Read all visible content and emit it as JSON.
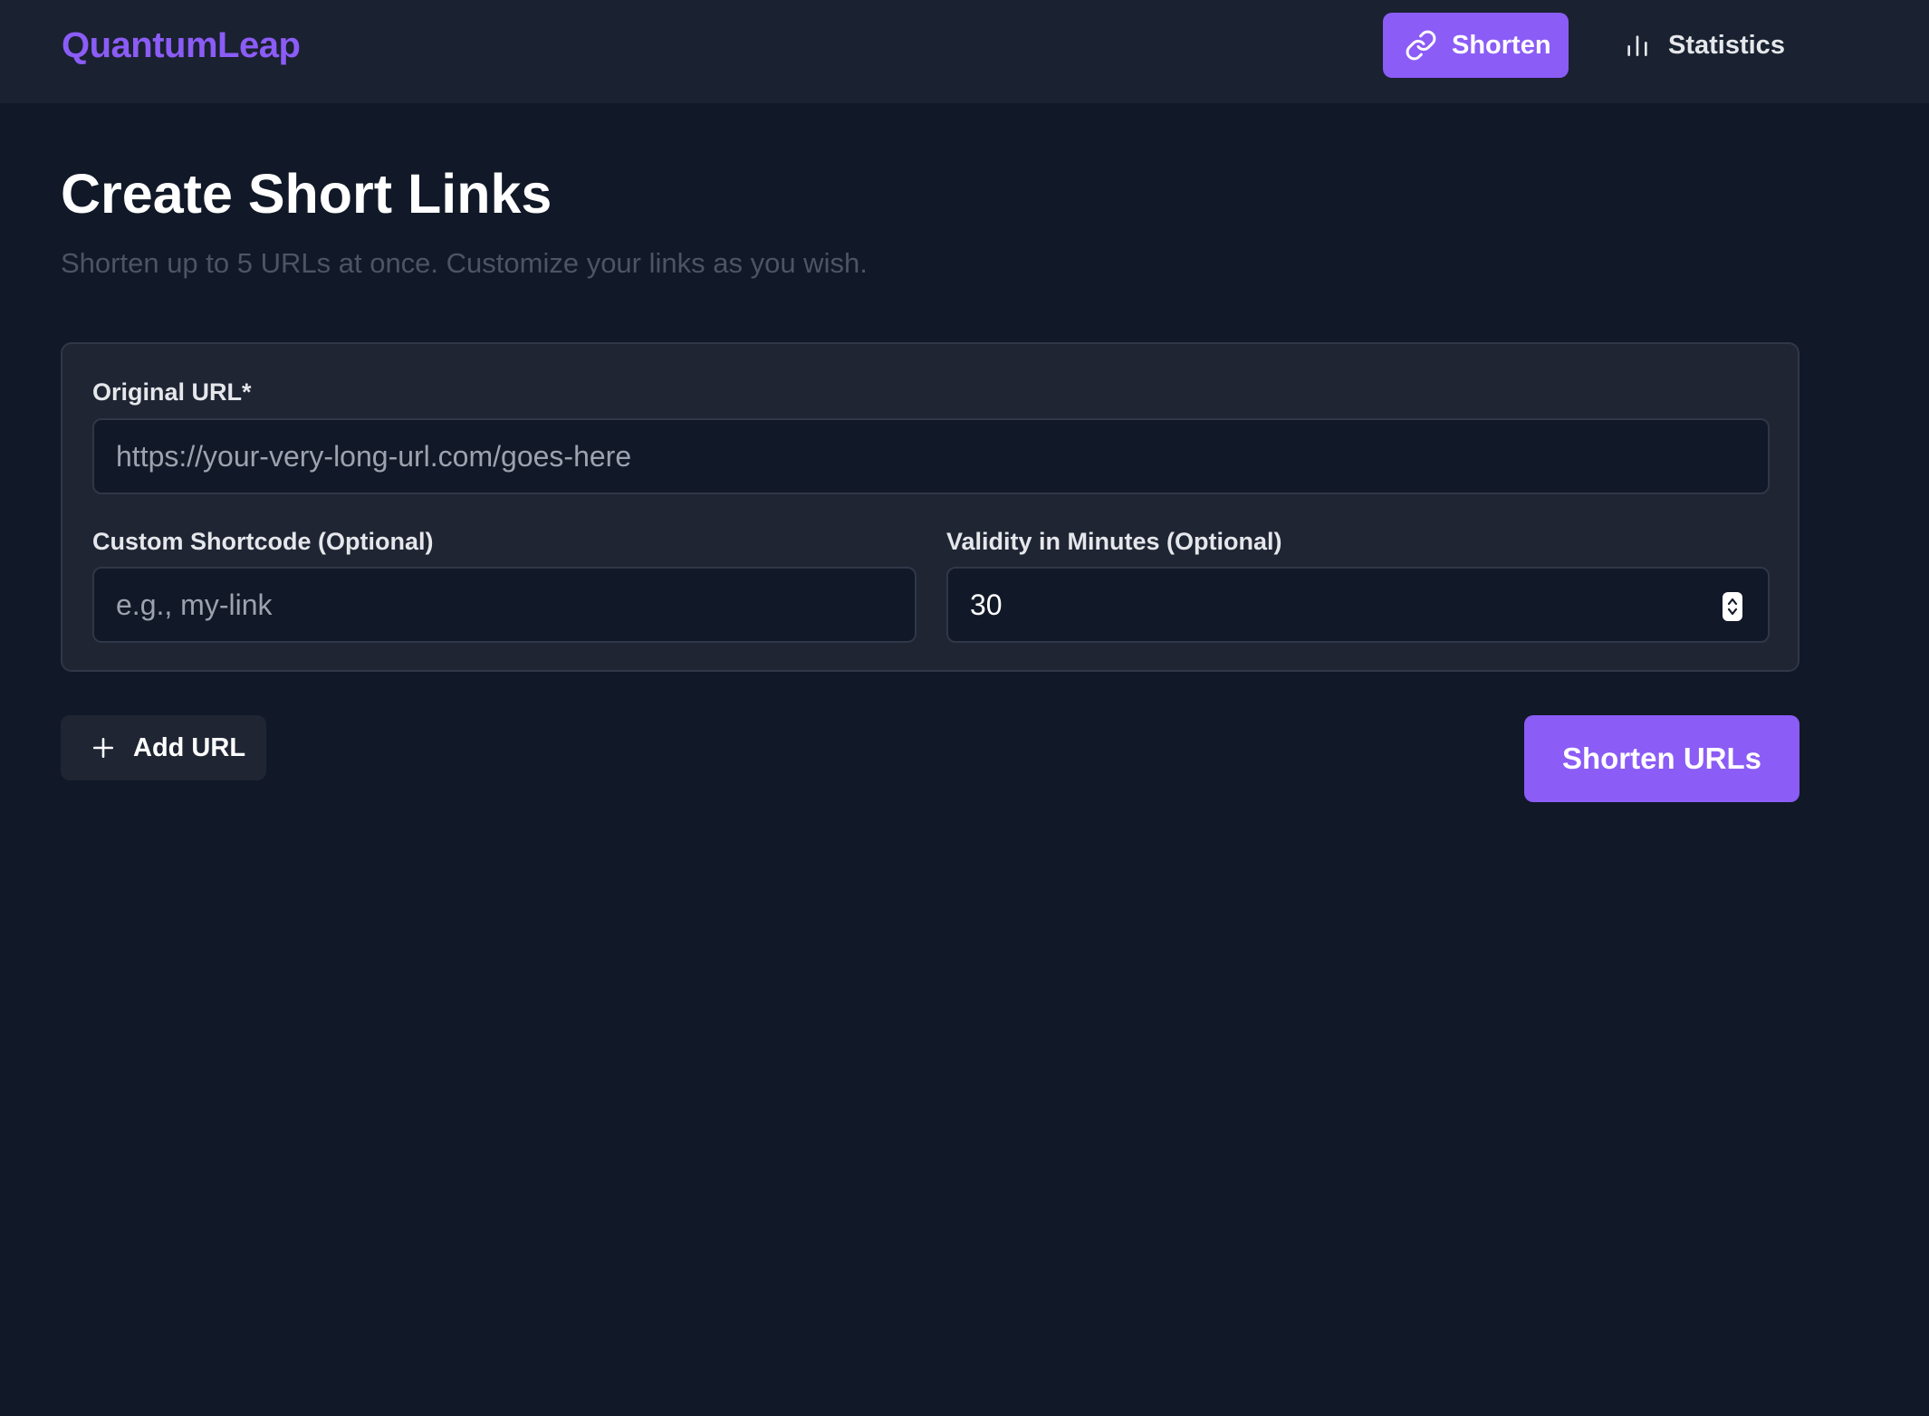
{
  "app": {
    "name": "QuantumLeap"
  },
  "nav": {
    "items": [
      {
        "label": "Shorten",
        "icon": "link-icon",
        "active": true
      },
      {
        "label": "Statistics",
        "icon": "bar-chart-icon",
        "active": false
      }
    ]
  },
  "page": {
    "title": "Create Short Links",
    "subtitle": "Shorten up to 5 URLs at once. Customize your links as you wish."
  },
  "form": {
    "original_url": {
      "label": "Original URL*",
      "value": "",
      "placeholder": "https://your-very-long-url.com/goes-here"
    },
    "shortcode": {
      "label": "Custom Shortcode (Optional)",
      "value": "",
      "placeholder": "e.g., my-link"
    },
    "validity": {
      "label": "Validity in Minutes (Optional)",
      "value": "30"
    }
  },
  "actions": {
    "add_url_label": "Add URL",
    "submit_label": "Shorten URLs"
  },
  "colors": {
    "accent": "#8b5cf6",
    "background": "#111827",
    "header": "#1a2130",
    "card": "#1f2533",
    "border": "#2f3748",
    "muted_text": "#4b5563",
    "placeholder": "#9ca3af"
  }
}
